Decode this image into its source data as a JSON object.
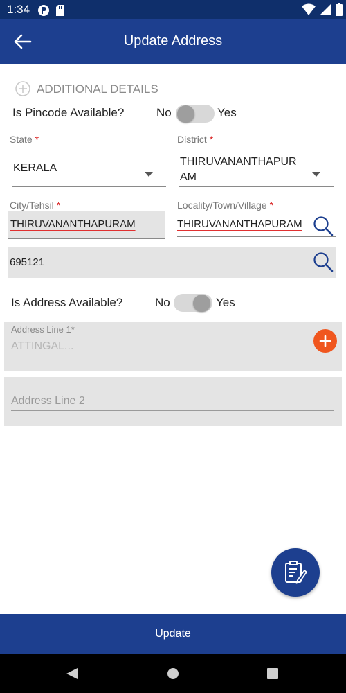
{
  "status_bar": {
    "time": "1:34"
  },
  "app_bar": {
    "title": "Update Address"
  },
  "additional": {
    "label": "ADDITIONAL DETAILS"
  },
  "pincode_toggle": {
    "question": "Is Pincode Available?",
    "no": "No",
    "yes": "Yes"
  },
  "state": {
    "label": "State",
    "required_mark": "*",
    "value": "KERALA"
  },
  "district": {
    "label": "District",
    "required_mark": "*",
    "value_line1": "THIRUVANANTHAPUR",
    "value_line2": "AM"
  },
  "city": {
    "label": "City/Tehsil",
    "required_mark": "*",
    "value": "THIRUVANANTHAPURAM"
  },
  "locality": {
    "label": "Locality/Town/Village",
    "required_mark": "*",
    "value": "THIRUVANANTHAPURAM"
  },
  "pincode": {
    "value": "695121"
  },
  "address_toggle": {
    "question": "Is Address Available?",
    "no": "No",
    "yes": "Yes"
  },
  "address1": {
    "label": "Address Line 1*",
    "placeholder": "ATTINGAL..."
  },
  "address2": {
    "placeholder": "Address Line 2"
  },
  "footer": {
    "update_label": "Update"
  },
  "colors": {
    "primary": "#1d3f8f",
    "accent": "#f0561e",
    "required": "#d92020"
  }
}
